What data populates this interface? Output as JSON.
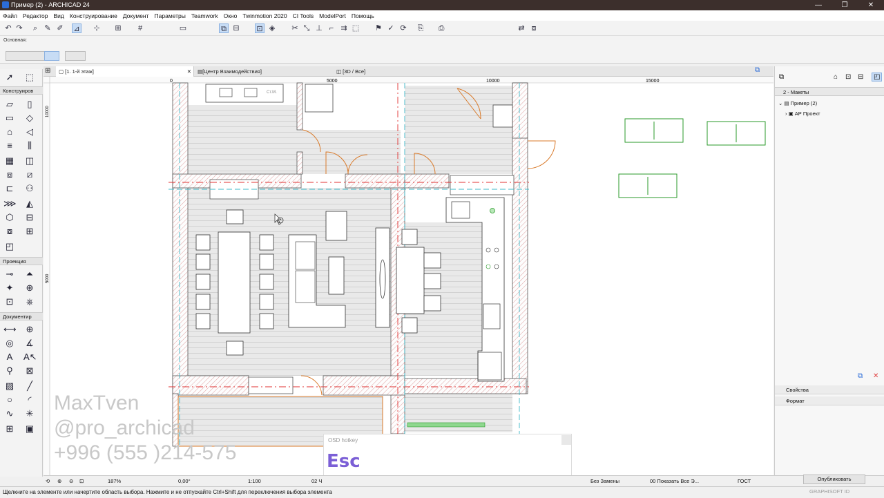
{
  "window": {
    "title": "Пример (2) - ARCHICAD 24",
    "controls": [
      "—",
      "❐",
      "✕"
    ]
  },
  "menu": [
    "Файл",
    "Редактор",
    "Вид",
    "Конструирование",
    "Документ",
    "Параметры",
    "Teamwork",
    "Окно",
    "Twinmotion 2020",
    "CI Tools",
    "ModelPort",
    "Помощь"
  ],
  "infobar": {
    "label": "Основная:"
  },
  "toolbox": {
    "sections": [
      "Конструиров",
      "Проекция",
      "Документир"
    ]
  },
  "tabs": [
    {
      "label": "[1. 1-й этаж]",
      "close": "✕"
    },
    {
      "label": "[Центр Взаимодействия]"
    },
    {
      "label": "[3D / Все]"
    }
  ],
  "ruler": {
    "marks": [
      "0",
      "5000",
      "10000",
      "15000"
    ],
    "vmarks": [
      "10000",
      "5000"
    ]
  },
  "plan_labels": {
    "closet": "Ст.М."
  },
  "watermark": {
    "line1": "MaxTven",
    "line2": "@pro_archicad",
    "line3": "+996 (555 )214-575"
  },
  "osd": {
    "header": "OSD hotkey",
    "key": "Esc"
  },
  "navigator": {
    "panel_title": "2 - Макеты",
    "tree": [
      {
        "label": "Пример (2)",
        "level": 0
      },
      {
        "label": "АР Проект",
        "level": 1
      }
    ],
    "sections": [
      "Свойства",
      "Формат"
    ]
  },
  "status_controls": {
    "zoom": "187%",
    "angle": "0,00°",
    "scale": "1:100",
    "layer": "02 Ч",
    "override": "Без Замены",
    "model_view": "00 Показать Все Э...",
    "standard": "ГОСТ"
  },
  "publish_button": "Опубликовать",
  "brand": "GRAPHISOFT ID",
  "status_message": "Щелкните на элементе или начертите область выбора. Нажмите и не отпускайте Ctrl+Shift для переключения выбора элемента"
}
